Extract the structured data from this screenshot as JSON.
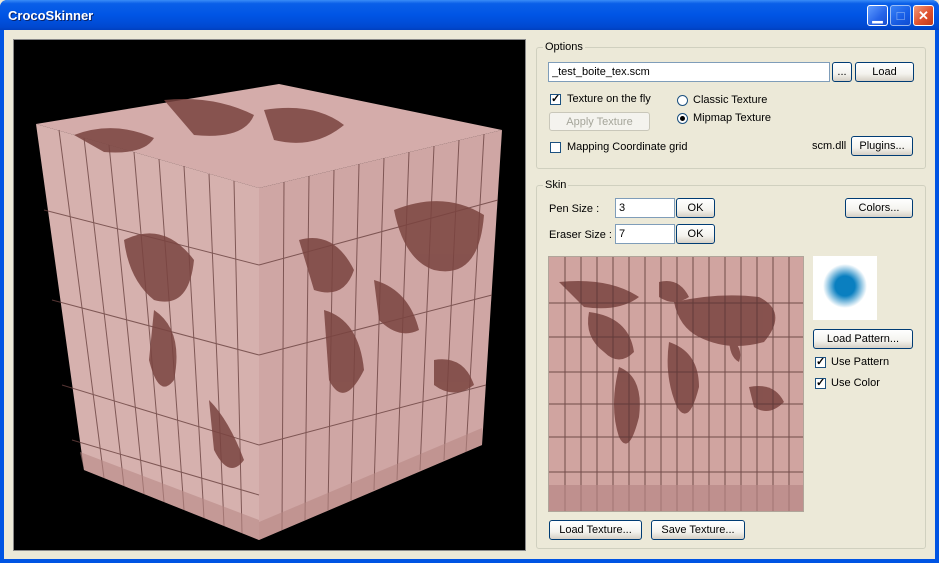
{
  "window": {
    "title": "CrocoSkinner"
  },
  "options": {
    "legend": "Options",
    "file_value": "_test_boite_tex.scm",
    "browse_label": "...",
    "load_label": "Load",
    "texture_on_fly_label": "Texture on the fly",
    "texture_on_fly_checked": true,
    "apply_texture_label": "Apply Texture",
    "classic_texture_label": "Classic Texture",
    "mipmap_texture_label": "Mipmap Texture",
    "selected_texture_mode": "Mipmap Texture",
    "mapping_grid_label": "Mapping Coordinate grid",
    "mapping_grid_checked": false,
    "plugin_dll": "scm.dll",
    "plugins_label": "Plugins..."
  },
  "skin": {
    "legend": "Skin",
    "pen_size_label": "Pen Size :",
    "pen_size_value": "3",
    "pen_ok_label": "OK",
    "eraser_size_label": "Eraser Size :",
    "eraser_size_value": "7",
    "eraser_ok_label": "OK",
    "colors_label": "Colors...",
    "load_pattern_label": "Load Pattern...",
    "use_pattern_label": "Use Pattern",
    "use_pattern_checked": true,
    "use_color_label": "Use Color",
    "use_color_checked": true,
    "load_texture_label": "Load Texture...",
    "save_texture_label": "Save Texture..."
  },
  "colors": {
    "titlebar": "#0055e5",
    "texture_base": "#d0a4a0",
    "land": "#7a4440",
    "pattern_brush": "#0a7fc0"
  }
}
